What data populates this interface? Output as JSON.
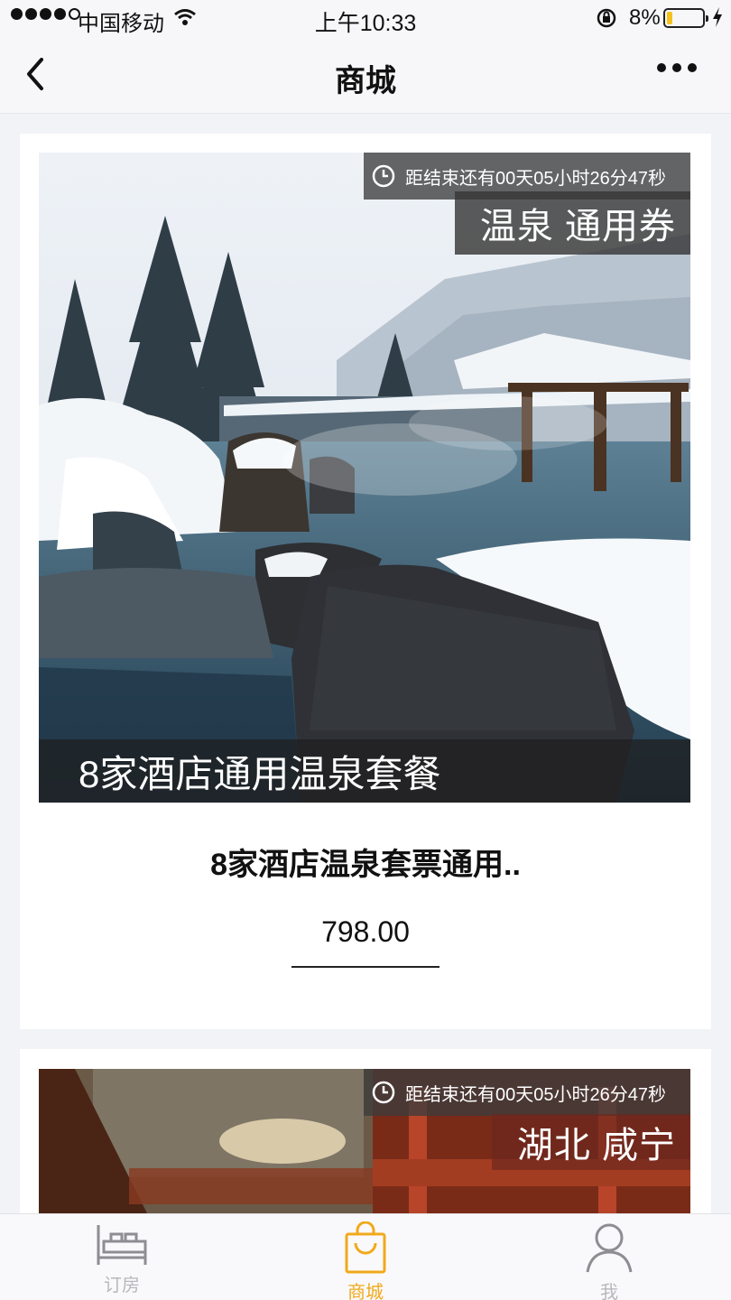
{
  "status_bar": {
    "carrier": "中国移动",
    "time": "上午10:33",
    "battery": "8%"
  },
  "nav": {
    "title": "商城"
  },
  "products": [
    {
      "countdown": "距结束还有00天05小时26分47秒",
      "tag": "温泉 通用券",
      "banner": "8家酒店通用温泉套餐",
      "title": "8家酒店温泉套票通用..",
      "price": "798.00"
    },
    {
      "countdown": "距结束还有00天05小时26分47秒",
      "tag": "湖北 咸宁"
    }
  ],
  "tabbar": {
    "rooms": "订房",
    "mall": "商城",
    "me": "我",
    "active_color": "#f1a91b"
  }
}
